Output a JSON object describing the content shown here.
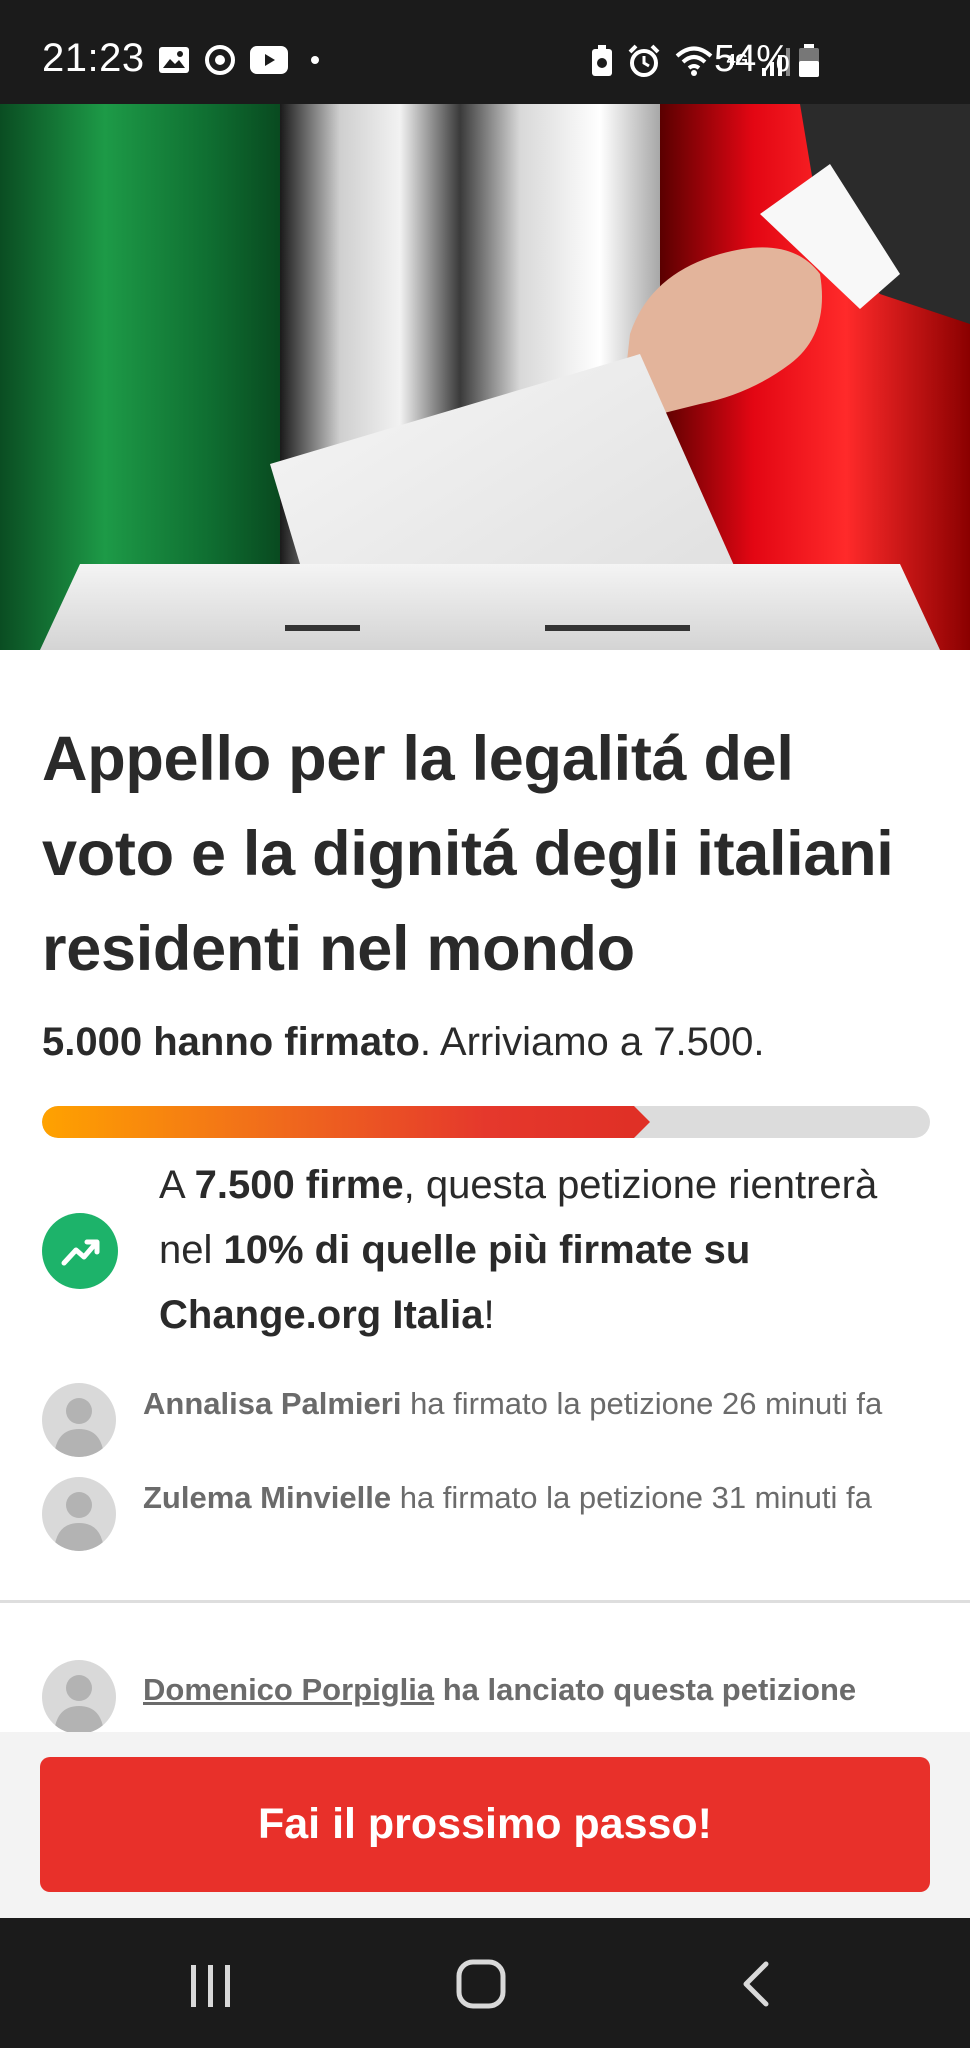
{
  "status_bar": {
    "time": "21:23",
    "battery": "54%",
    "network": "4G",
    "icons_left": [
      "gallery-icon",
      "sync-icon",
      "youtube-icon",
      "dot-icon"
    ],
    "icons_right": [
      "battery-saver-icon",
      "alarm-icon",
      "wifi-icon",
      "signal-icon",
      "battery-icon"
    ]
  },
  "hero": {
    "description_icon": "ballot-box-image"
  },
  "petition": {
    "title": "Appello per la legalitá del voto e la dignitá degli italiani residenti nel mondo",
    "signed_count": "5.000 hanno firmato",
    "goal_text": ". Arriviamo a 7.500.",
    "progress_fraction": 0.6667
  },
  "milestone": {
    "prefix": "A ",
    "target": "7.500 firme",
    "middle": ", questa petizione rientrerà nel ",
    "highlight": "10% di quelle più firmate su Change.org Italia",
    "suffix": "!"
  },
  "recent_signers": [
    {
      "name": "Annalisa Palmieri",
      "text": " ha firmato la petizione 26 minuti fa"
    },
    {
      "name": "Zulema Minvielle",
      "text": " ha firmato la petizione 31 minuti fa"
    }
  ],
  "creator": {
    "name": "Domenico Porpiglia",
    "text": " ha lanciato questa petizione"
  },
  "cta": {
    "label": "Fai il prossimo passo!"
  },
  "colors": {
    "cta": "#e8302a",
    "trend": "#1db36a",
    "progress_start": "#ffa200",
    "progress_end": "#e03026"
  }
}
